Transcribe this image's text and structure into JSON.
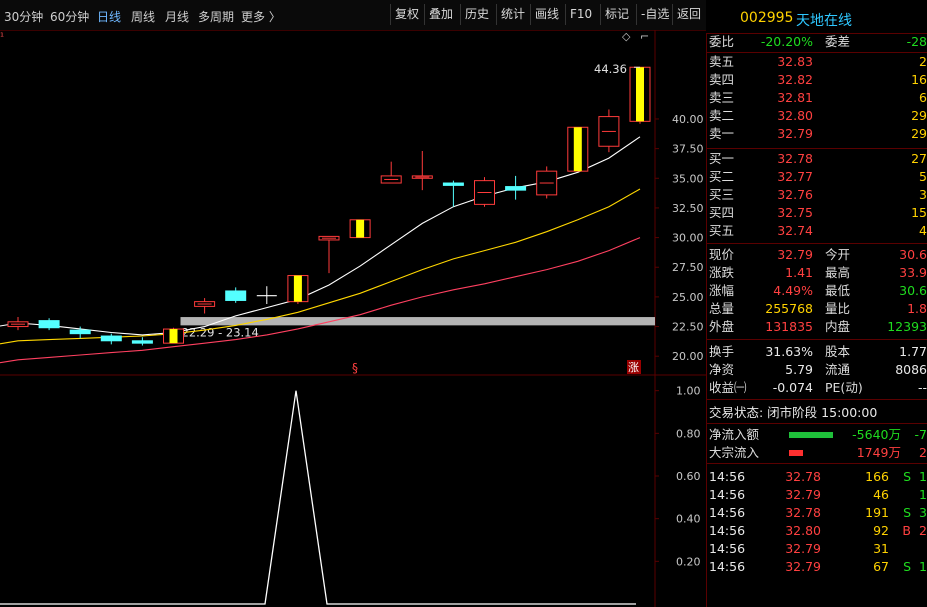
{
  "toolbar": {
    "periods": [
      {
        "label": "30分钟",
        "active": false
      },
      {
        "label": "60分钟",
        "active": false
      },
      {
        "label": "日线",
        "active": true
      },
      {
        "label": "周线",
        "active": false
      },
      {
        "label": "月线",
        "active": false
      },
      {
        "label": "多周期",
        "active": false
      },
      {
        "label": "更多 〉",
        "active": false
      }
    ],
    "actions": [
      "复权",
      "叠加",
      "历史",
      "统计",
      "画线",
      "F10",
      "标记",
      "-自选",
      "返回"
    ]
  },
  "stock": {
    "code": "002995",
    "name": "天地在线"
  },
  "chart_data": [
    {
      "type": "candlestick",
      "title": "",
      "ylim": [
        18.5,
        47.5
      ],
      "yticks": [
        "40.00",
        "37.50",
        "35.00",
        "32.50",
        "30.00",
        "27.50",
        "25.00",
        "22.50",
        "20.00"
      ],
      "ytick_values": [
        40,
        37.5,
        35,
        32.5,
        30,
        27.5,
        25,
        22.5,
        20
      ],
      "candles": [
        {
          "o": 22.5,
          "h": 23.3,
          "l": 22.2,
          "c": 22.9,
          "dir": "up"
        },
        {
          "o": 23.0,
          "h": 23.2,
          "l": 22.2,
          "c": 22.4,
          "dir": "down"
        },
        {
          "o": 22.2,
          "h": 22.5,
          "l": 21.5,
          "c": 21.9,
          "dir": "down"
        },
        {
          "o": 21.7,
          "h": 21.9,
          "l": 21.0,
          "c": 21.3,
          "dir": "down"
        },
        {
          "o": 21.3,
          "h": 21.6,
          "l": 20.9,
          "c": 21.1,
          "dir": "down"
        },
        {
          "o": 21.1,
          "h": 22.4,
          "l": 21.1,
          "c": 22.29,
          "dir": "up_solid"
        },
        {
          "o": 24.2,
          "h": 24.9,
          "l": 23.6,
          "c": 24.6,
          "dir": "up"
        },
        {
          "o": 24.7,
          "h": 25.8,
          "l": 24.5,
          "c": 25.5,
          "dir": "down"
        },
        {
          "o": 25.1,
          "h": 25.9,
          "l": 24.4,
          "c": 25.1,
          "dir": "doji"
        },
        {
          "o": 24.6,
          "h": 26.8,
          "l": 24.4,
          "c": 26.8,
          "dir": "up_solid"
        },
        {
          "o": 29.8,
          "h": 30.1,
          "l": 27.0,
          "c": 30.1,
          "dir": "up"
        },
        {
          "o": 30.0,
          "h": 31.5,
          "l": 30.0,
          "c": 31.5,
          "dir": "up_solid"
        },
        {
          "o": 34.6,
          "h": 36.4,
          "l": 34.6,
          "c": 35.2,
          "dir": "up"
        },
        {
          "o": 35.0,
          "h": 37.3,
          "l": 34.0,
          "c": 35.2,
          "dir": "up"
        },
        {
          "o": 34.6,
          "h": 34.8,
          "l": 32.6,
          "c": 34.4,
          "dir": "down"
        },
        {
          "o": 32.8,
          "h": 35.1,
          "l": 32.6,
          "c": 34.8,
          "dir": "up"
        },
        {
          "o": 34.3,
          "h": 35.2,
          "l": 33.2,
          "c": 34.0,
          "dir": "down"
        },
        {
          "o": 33.6,
          "h": 36.0,
          "l": 33.3,
          "c": 35.6,
          "dir": "up"
        },
        {
          "o": 35.6,
          "h": 39.3,
          "l": 35.6,
          "c": 39.3,
          "dir": "up_solid"
        },
        {
          "o": 37.7,
          "h": 40.8,
          "l": 37.2,
          "c": 40.2,
          "dir": "up"
        },
        {
          "o": 39.8,
          "h": 44.36,
          "l": 39.6,
          "c": 44.36,
          "dir": "up_solid"
        }
      ],
      "ma": [
        {
          "name": "",
          "color": "#ffffff",
          "values": [
            22.8,
            22.6,
            22.3,
            22.0,
            21.8,
            22.0,
            22.5,
            23.4,
            24.1,
            24.8,
            26.0,
            27.6,
            29.4,
            31.2,
            32.6,
            33.5,
            34.2,
            34.7,
            35.5,
            36.7,
            38.5
          ]
        },
        {
          "name": "",
          "color": "#ffd700",
          "values": [
            21.3,
            21.4,
            21.5,
            21.6,
            21.7,
            21.9,
            22.2,
            22.6,
            23.1,
            23.7,
            24.5,
            25.3,
            26.3,
            27.3,
            28.2,
            28.9,
            29.6,
            30.5,
            31.5,
            32.6,
            34.1
          ]
        },
        {
          "name": "",
          "color": "#ff4060",
          "values": [
            19.7,
            19.9,
            20.1,
            20.3,
            20.5,
            20.8,
            21.1,
            21.4,
            21.8,
            22.3,
            22.9,
            23.5,
            24.3,
            25.0,
            25.6,
            26.1,
            26.7,
            27.3,
            28.0,
            28.9,
            30.0
          ]
        }
      ],
      "annotations": {
        "high_label": "44.36",
        "range_label": "22.29 - 23.14",
        "range_band": [
          22.6,
          23.3
        ],
        "mark_s": "§",
        "mark_zhang": "涨"
      }
    },
    {
      "type": "line",
      "title": "",
      "ylim": [
        0,
        1.05
      ],
      "yticks": [
        "1.00",
        "0.80",
        "0.60",
        "0.40",
        "0.20"
      ],
      "ytick_values": [
        1,
        0.8,
        0.6,
        0.4,
        0.2
      ],
      "values": [
        0,
        0,
        0,
        0,
        0,
        0,
        0,
        0,
        0,
        1,
        0,
        0,
        0,
        0,
        0,
        0,
        0,
        0,
        0,
        0,
        0
      ],
      "color": "#ffffff"
    }
  ],
  "quote": {
    "weibi_label": "委比",
    "weibi": "-20.20%",
    "weicha_label": "委差",
    "weicha": "-28",
    "sell": [
      {
        "label": "卖五",
        "price": "32.83",
        "vol": "2"
      },
      {
        "label": "卖四",
        "price": "32.82",
        "vol": "16"
      },
      {
        "label": "卖三",
        "price": "32.81",
        "vol": "6"
      },
      {
        "label": "卖二",
        "price": "32.80",
        "vol": "29"
      },
      {
        "label": "卖一",
        "price": "32.79",
        "vol": "29"
      }
    ],
    "buy": [
      {
        "label": "买一",
        "price": "32.78",
        "vol": "27"
      },
      {
        "label": "买二",
        "price": "32.77",
        "vol": "5"
      },
      {
        "label": "买三",
        "price": "32.76",
        "vol": "3"
      },
      {
        "label": "买四",
        "price": "32.75",
        "vol": "15"
      },
      {
        "label": "买五",
        "price": "32.74",
        "vol": "4"
      }
    ],
    "stats": [
      {
        "l1": "现价",
        "v1": "32.79",
        "c1": "red",
        "l2": "今开",
        "v2": "30.6",
        "c2": "red"
      },
      {
        "l1": "涨跌",
        "v1": "1.41",
        "c1": "red",
        "l2": "最高",
        "v2": "33.9",
        "c2": "red"
      },
      {
        "l1": "涨幅",
        "v1": "4.49%",
        "c1": "red",
        "l2": "最低",
        "v2": "30.6",
        "c2": "green"
      },
      {
        "l1": "总量",
        "v1": "255768",
        "c1": "yellow",
        "l2": "量比",
        "v2": "1.8",
        "c2": "red"
      },
      {
        "l1": "外盘",
        "v1": "131835",
        "c1": "red",
        "l2": "内盘",
        "v2": "12393",
        "c2": "green"
      }
    ],
    "stats2": [
      {
        "l1": "换手",
        "v1": "31.63%",
        "c1": "white",
        "l2": "股本",
        "v2": "1.77",
        "c2": "white"
      },
      {
        "l1": "净资",
        "v1": "5.79",
        "c1": "white",
        "l2": "流通",
        "v2": "8086",
        "c2": "white"
      },
      {
        "l1": "收益㈠",
        "v1": "-0.074",
        "c1": "white",
        "l2": "PE(动)",
        "v2": "--",
        "c2": "white"
      }
    ],
    "trade_status": "交易状态: 闭市阶段 15:00:00",
    "flows": [
      {
        "label": "净流入额",
        "bar": "green",
        "value": "-5640万",
        "value_color": "green",
        "extra": "-7",
        "extra_color": "green",
        "fraction": 0.8
      },
      {
        "label": "大宗流入",
        "bar": "red",
        "value": "1749万",
        "value_color": "red",
        "extra": "2",
        "extra_color": "red",
        "fraction": 0.25
      }
    ],
    "ticks": [
      {
        "time": "14:56",
        "price": "32.78",
        "vol": "166",
        "flag": "S",
        "n": "1"
      },
      {
        "time": "14:56",
        "price": "32.79",
        "vol": "46",
        "flag": "",
        "n": "1"
      },
      {
        "time": "14:56",
        "price": "32.78",
        "vol": "191",
        "flag": "S",
        "n": "3"
      },
      {
        "time": "14:56",
        "price": "32.80",
        "vol": "92",
        "flag": "B",
        "n": "2"
      },
      {
        "time": "14:56",
        "price": "32.79",
        "vol": "31",
        "flag": "",
        "n": ""
      },
      {
        "time": "14:56",
        "price": "32.79",
        "vol": "67",
        "flag": "S",
        "n": "1"
      }
    ]
  }
}
